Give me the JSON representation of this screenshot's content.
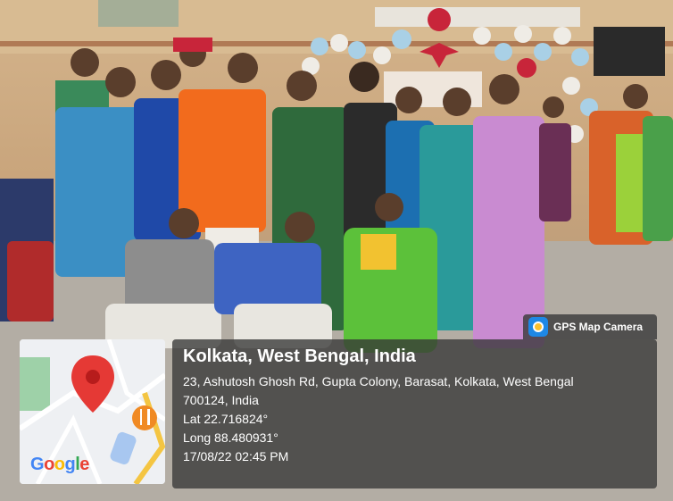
{
  "overlay": {
    "app_name": "GPS Map Camera",
    "app_icon": "gps-map-camera-icon",
    "location_title": "Kolkata, West Bengal, India",
    "address_line1": "23, Ashutosh Ghosh Rd, Gupta Colony, Barasat, Kolkata, West Bengal",
    "address_line2": "700124, India",
    "latitude": "Lat 22.716824°",
    "longitude": "Long 88.480931°",
    "datetime": "17/08/22 02:45 PM"
  },
  "map": {
    "logo": [
      "G",
      "o",
      "o",
      "g",
      "l",
      "e"
    ],
    "logo_colors": [
      "#4285F4",
      "#EA4335",
      "#FBBC05",
      "#4285F4",
      "#34A853",
      "#EA4335"
    ],
    "pin_icon": "location-pin-icon",
    "poi_icon": "restaurant-icon"
  },
  "photo": {
    "description_icon": "group-photo",
    "colors": {
      "wall": "#c9a57c",
      "floor": "#b0aaa2",
      "balloon_blue": "#a9d0e6",
      "balloon_white": "#efece6",
      "decoration_red": "#c8253a"
    }
  }
}
